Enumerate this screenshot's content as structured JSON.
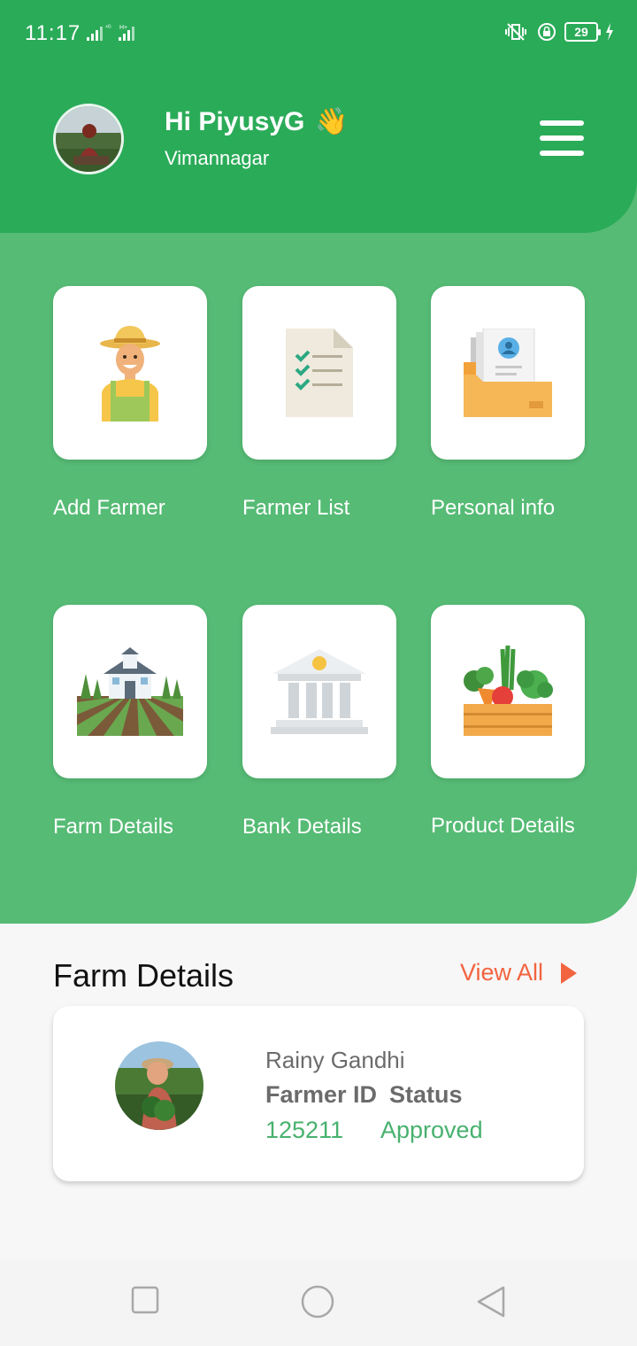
{
  "status_bar": {
    "time": "11:17",
    "battery": "29"
  },
  "header": {
    "greeting": "Hi PiyusyG",
    "wave_emoji": "👋",
    "location": "Vimannagar",
    "menu_icon": "hamburger-menu-icon"
  },
  "tiles": [
    {
      "label": "Add Farmer",
      "icon": "farmer-icon"
    },
    {
      "label": "Farmer List",
      "icon": "checklist-icon"
    },
    {
      "label": "Personal info",
      "icon": "profile-folder-icon"
    },
    {
      "label": "Farm Details",
      "icon": "farm-icon"
    },
    {
      "label": "Bank Details",
      "icon": "bank-icon"
    },
    {
      "label": "Product Details",
      "icon": "vegetable-crate-icon"
    }
  ],
  "farm_section": {
    "title": "Farm Details",
    "view_all": "View All",
    "card": {
      "name": "Rainy Gandhi",
      "id_label": "Farmer ID",
      "status_label": "Status",
      "id_value": "125211",
      "status_value": "Approved"
    }
  },
  "colors": {
    "header_green": "#2aab58",
    "panel_green": "#56bb75",
    "accent_orange": "#f26440",
    "value_green": "#48b16e"
  }
}
